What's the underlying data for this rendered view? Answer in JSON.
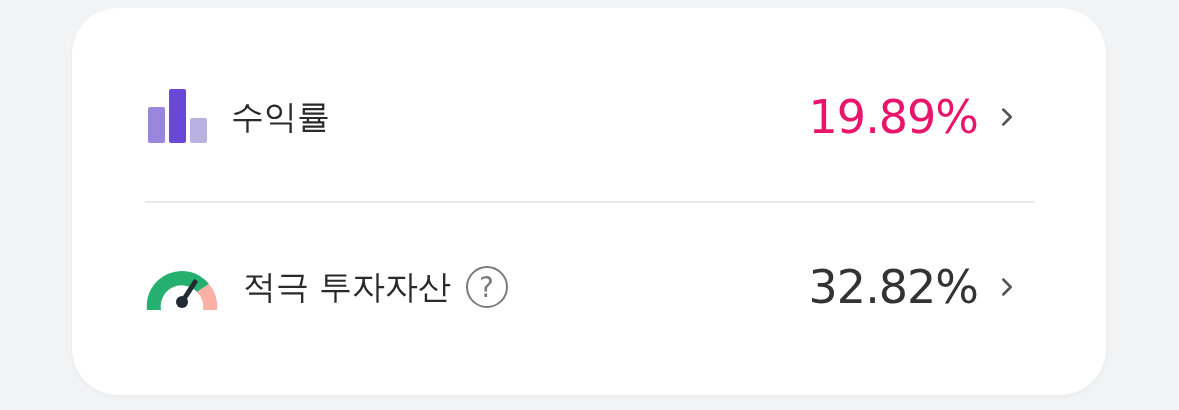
{
  "rows": [
    {
      "kind": "chart",
      "label": "수익률",
      "value": "19.89%",
      "color": "#e8156b"
    },
    {
      "kind": "gauge",
      "label": "적극 투자자산",
      "help": "?",
      "value": "32.82%",
      "color": "#333333"
    }
  ]
}
